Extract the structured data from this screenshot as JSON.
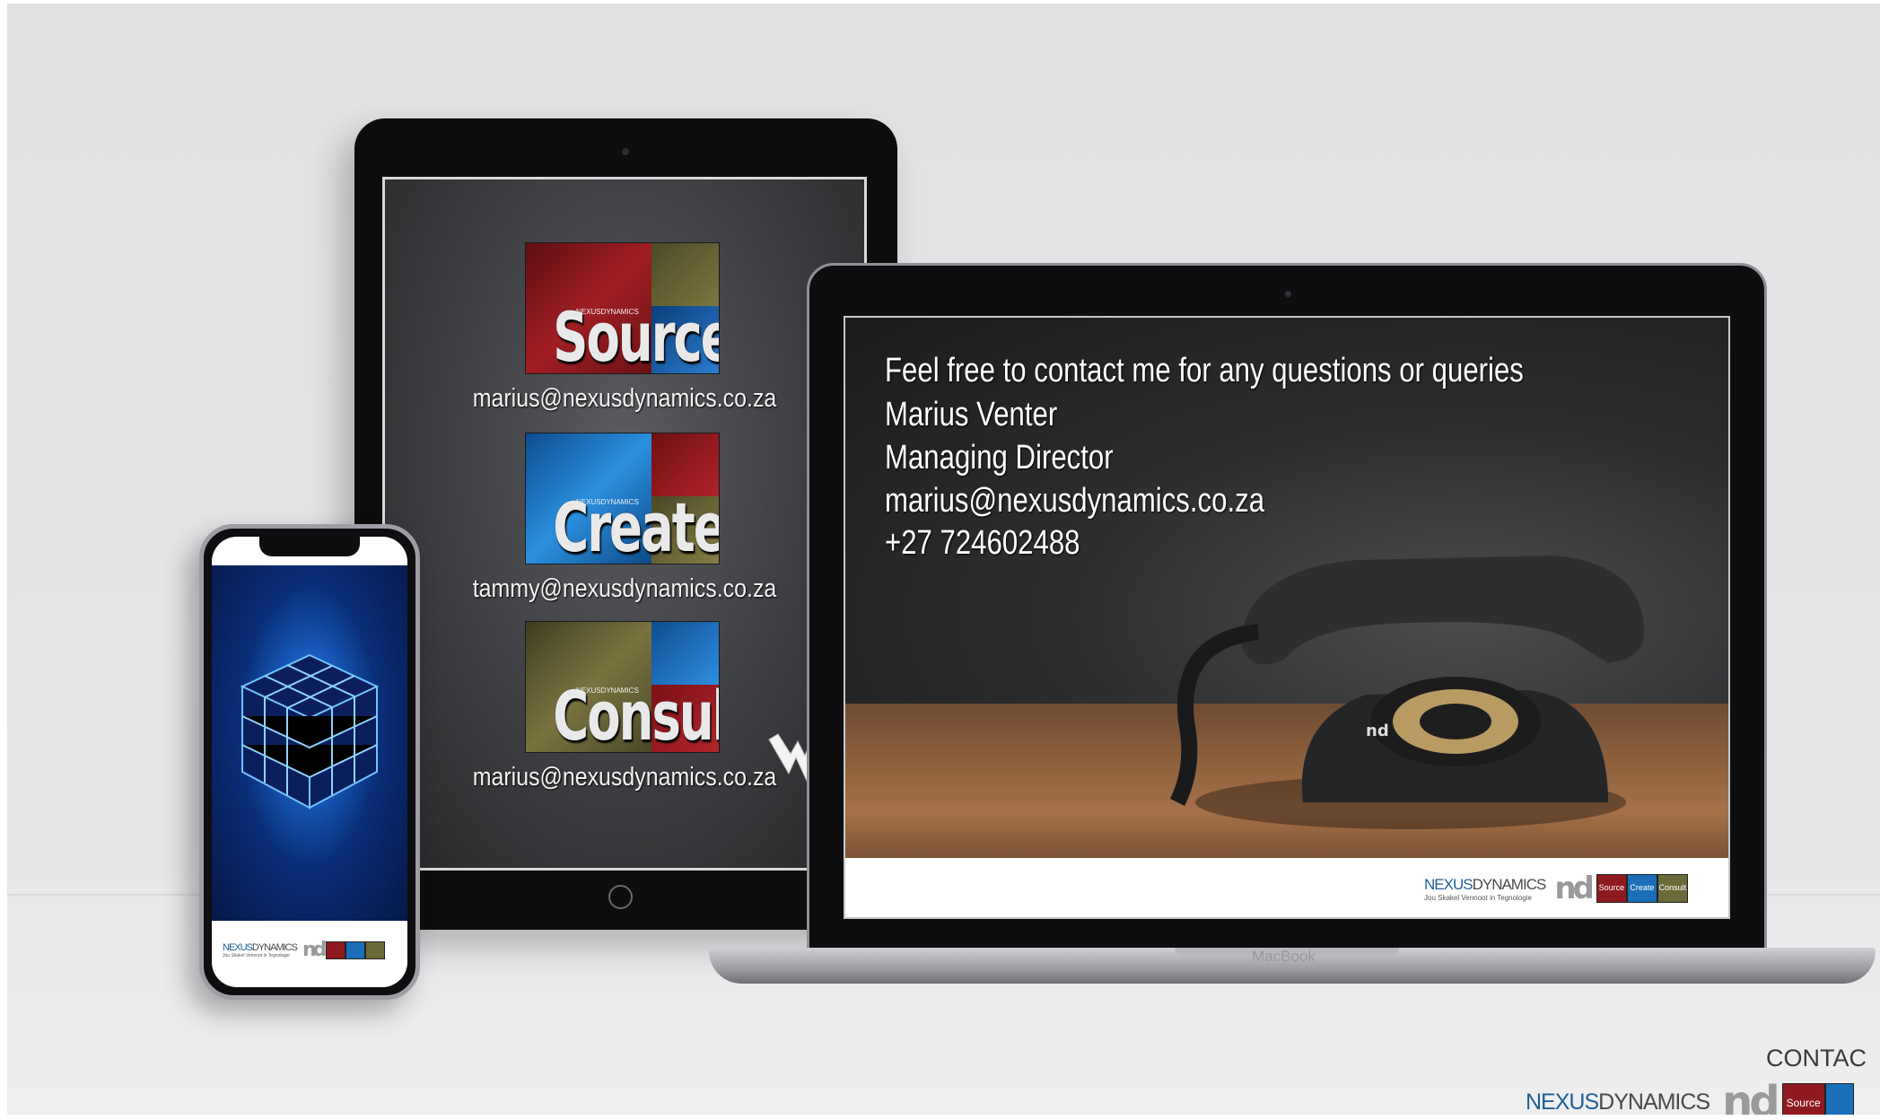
{
  "tablet": {
    "tiles": [
      {
        "word": "Source",
        "mini": "NEXUSDYNAMICS",
        "email": "marius@nexusdynamics.co.za"
      },
      {
        "word": "Create",
        "mini": "NEXUSDYNAMICS",
        "email": "tammy@nexusdynamics.co.za"
      },
      {
        "word": "Consult",
        "mini": "NEXUSDYNAMICS",
        "email": "marius@nexusdynamics.co.za"
      }
    ]
  },
  "laptop": {
    "contact_lines": [
      "Feel free to contact me for any questions or queries",
      "Marius Venter",
      "Managing Director",
      "marius@nexusdynamics.co.za",
      "+27 724602488"
    ],
    "photo_logo": "nd",
    "footer": {
      "brand_nexus": "NEXUS",
      "brand_dynamics": "DYNAMICS",
      "tagline": "Jou Skakel Vennoot in Tegnologie",
      "mark": "nd",
      "tiles": [
        "Source",
        "Create",
        "Consult"
      ]
    },
    "label": "MacBook"
  },
  "phone": {
    "brand_nexus": "NEXUS",
    "brand_dynamics": "DYNAMICS",
    "tagline": "Jou Skakel Vennoot in Tegnologie",
    "mark": "nd"
  },
  "corner": {
    "contact_fragment": "CONTAC",
    "brand_nexus": "NEXUS",
    "brand_dynamics": "DYNAMICS",
    "mark": "nd",
    "tile": "Source"
  },
  "colors": {
    "source_red": "#8e1a1f",
    "create_blue": "#1a6fb8",
    "consult_olive": "#6b6a3a",
    "nexus_blue": "#1f5f98"
  }
}
